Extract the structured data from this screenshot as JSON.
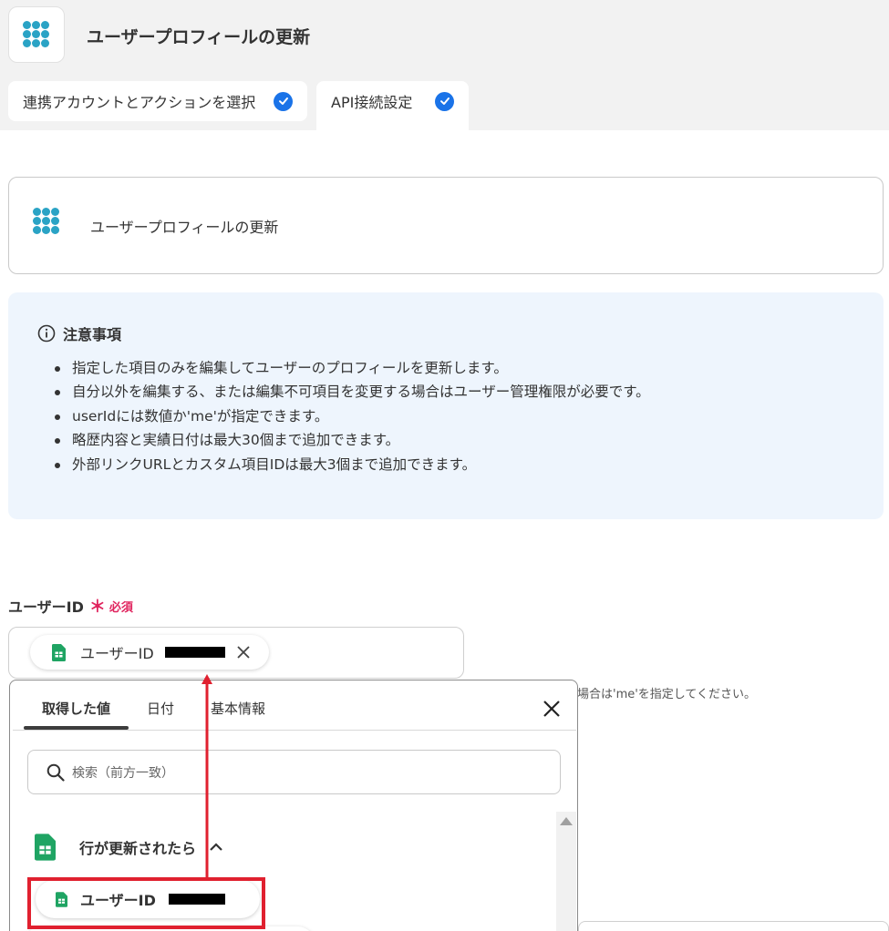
{
  "header": {
    "title": "ユーザープロフィールの更新",
    "app_icon": "yoom-dots-icon",
    "tabs": [
      {
        "label": "連携アカウントとアクションを選択",
        "done": true
      },
      {
        "label": "API接続設定",
        "done": true
      }
    ]
  },
  "action_card": {
    "title": "ユーザープロフィールの更新"
  },
  "notice": {
    "heading": "注意事項",
    "items": [
      "指定した項目のみを編集してユーザーのプロフィールを更新します。",
      "自分以外を編集する、または編集不可項目を変更する場合はユーザー管理権限が必要です。",
      "userIdには数値か'me'が指定できます。",
      "略歴内容と実績日付は最大30個まで追加できます。",
      "外部リンクURLとカスタム項目IDは最大3個まで追加できます。"
    ]
  },
  "user_id_field": {
    "label": "ユーザーID",
    "required_mark": "＊",
    "required_text": "必須",
    "chip_label": "ユーザーID",
    "helper_text": "場合は'me'を指定してください。"
  },
  "picker": {
    "tabs": [
      "取得した値",
      "日付",
      "基本情報"
    ],
    "active_tab": "取得した値",
    "search_placeholder": "検索（前方一致）",
    "group_label": "行が更新されたら",
    "item_label": "ユーザーID"
  },
  "colors": {
    "accent_blue": "#1a73e8",
    "required_red": "#e0245e",
    "highlight_red": "#e0202f",
    "notice_bg": "#eef5fd",
    "dots_teal": "#2aa3c5",
    "sheets_green": "#1fa463"
  }
}
